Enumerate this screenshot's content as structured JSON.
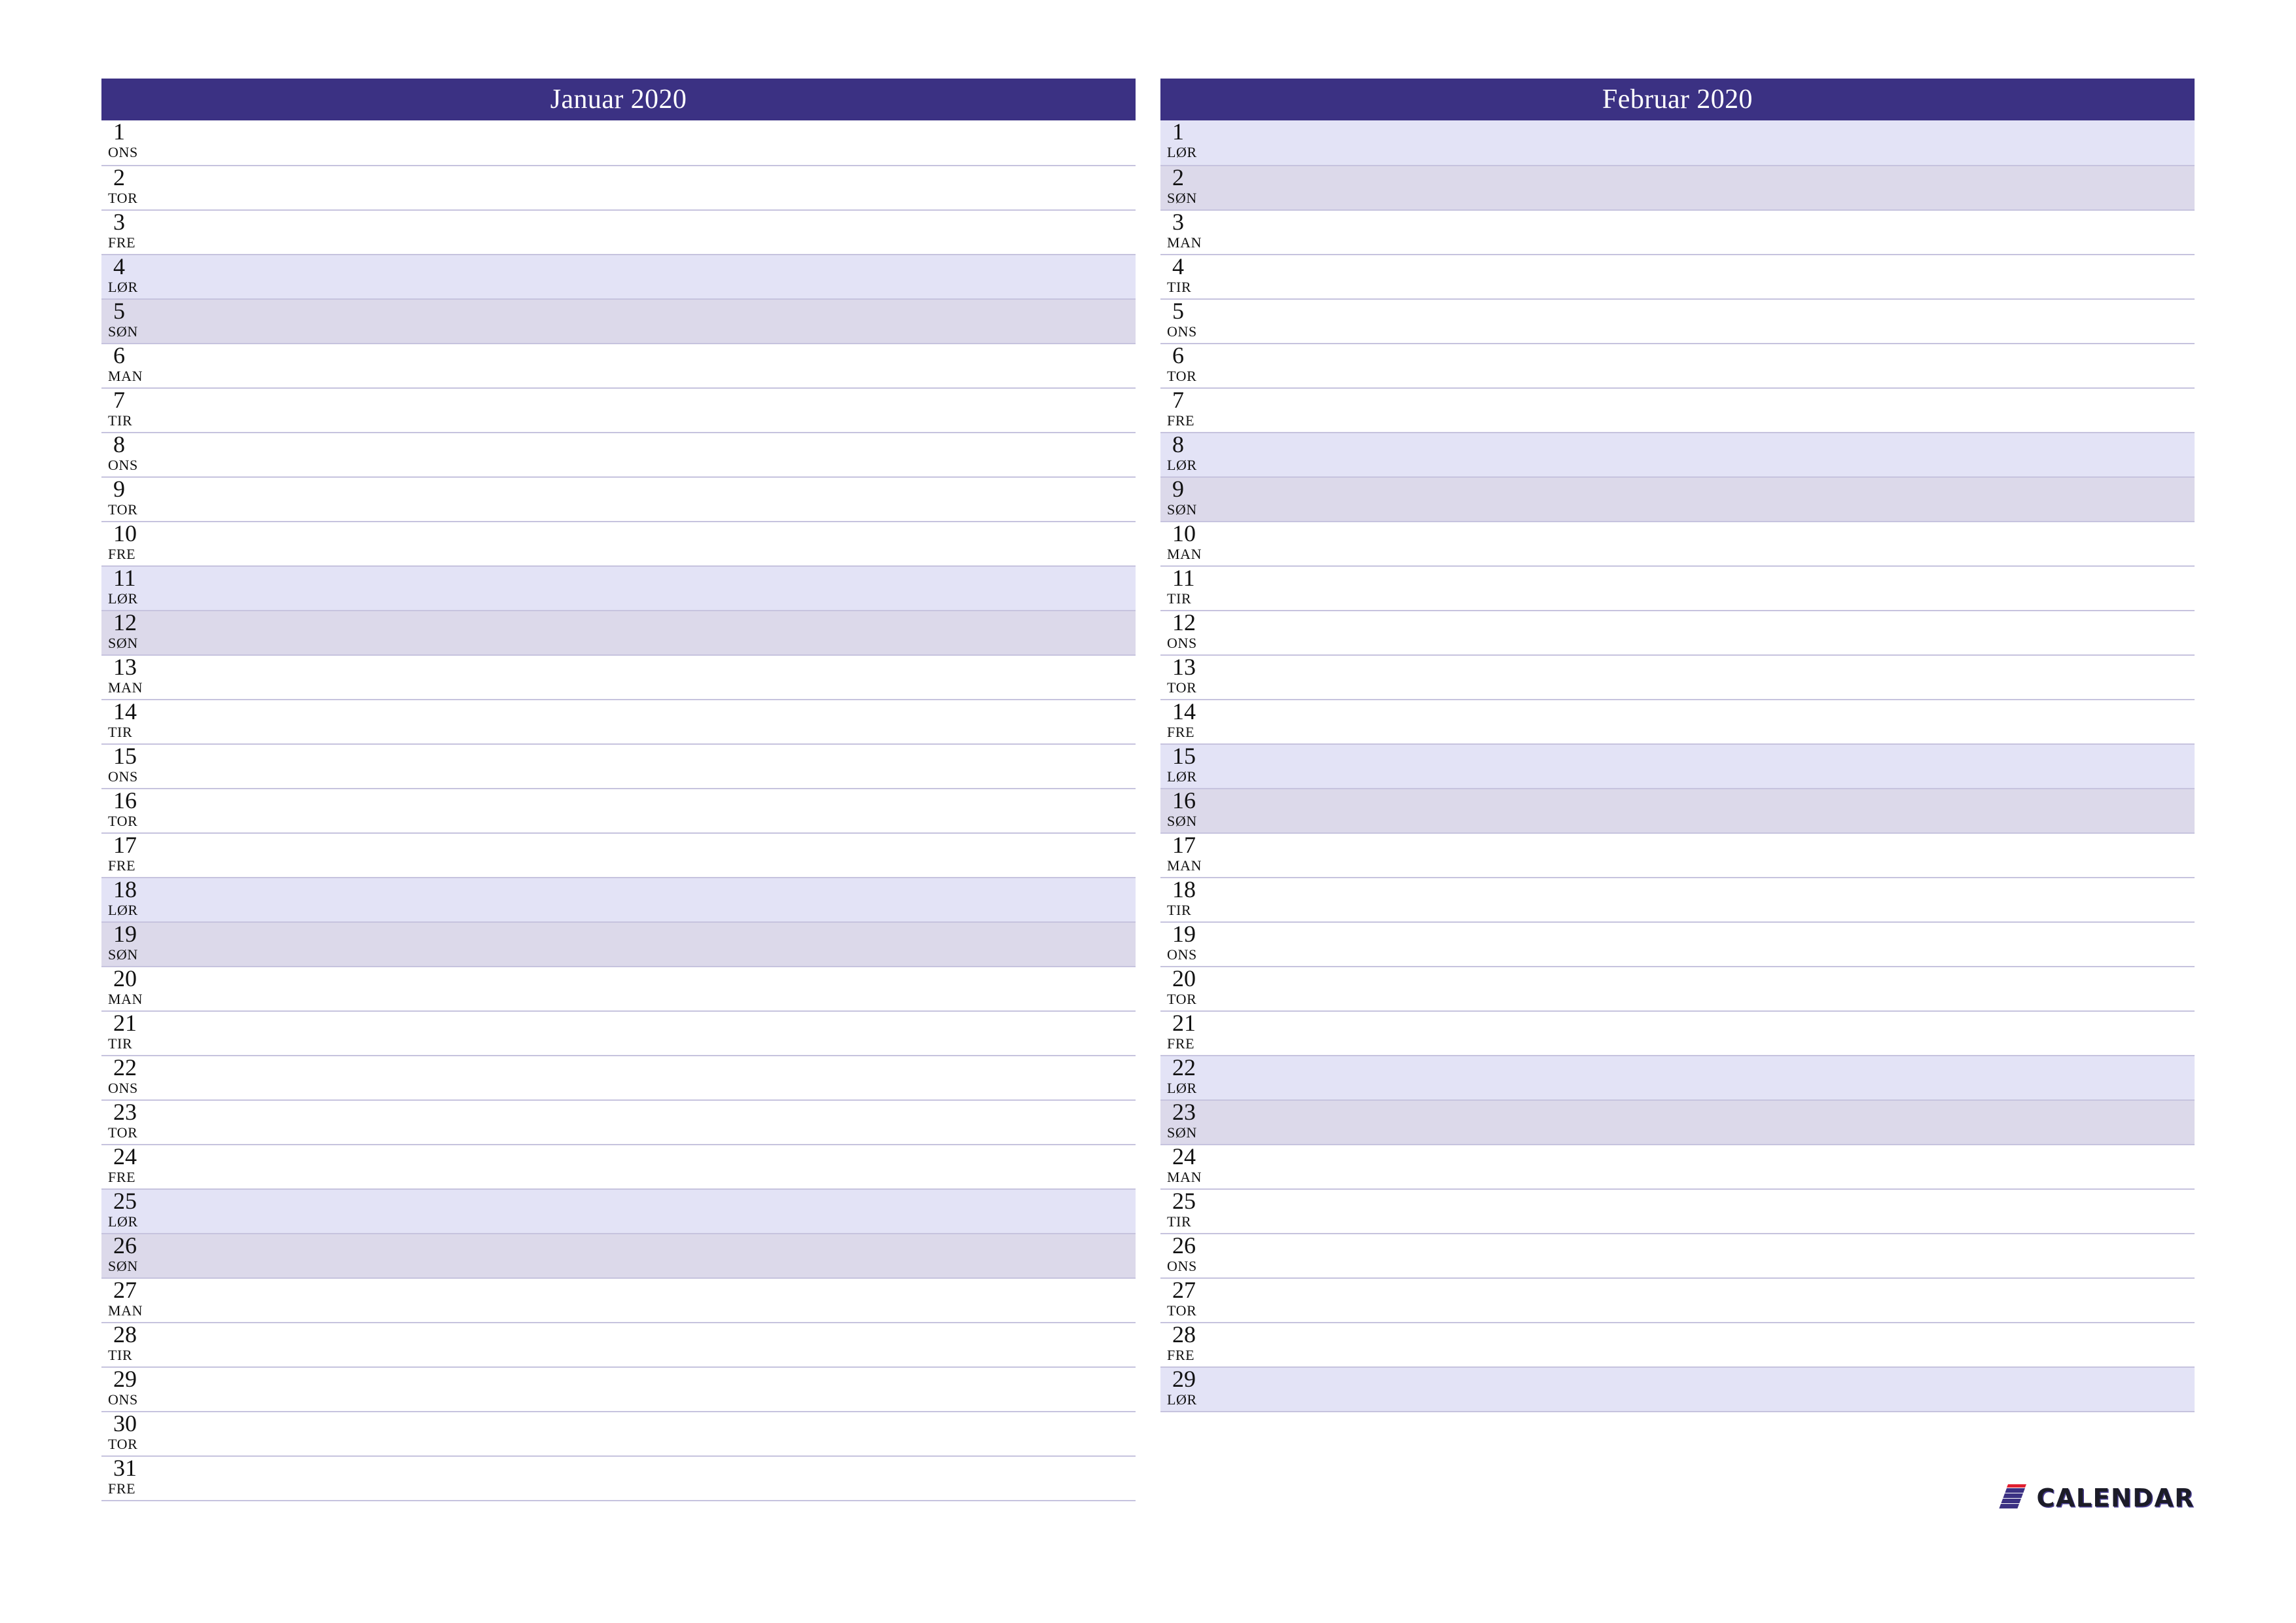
{
  "document": {
    "type": "monthly-planner",
    "year": "2020",
    "locale": "nb-NO"
  },
  "theme": {
    "header_bg": "#3b3183",
    "header_text": "#ffffff",
    "saturday_bg": "#e3e3f6",
    "sunday_bg": "#dcd9ea",
    "weekday_bg": "#ffffff",
    "rule_color": "#c6c3de",
    "text_color": "#111111",
    "brand_mark_color": "#3b3183",
    "brand_mark_accent": "#e02030",
    "brand_text_color": "#1c1c28"
  },
  "months": [
    {
      "title": "Januar 2020",
      "days": [
        {
          "num": "1",
          "name": "ONS",
          "kind": "weekday"
        },
        {
          "num": "2",
          "name": "TOR",
          "kind": "weekday"
        },
        {
          "num": "3",
          "name": "FRE",
          "kind": "weekday"
        },
        {
          "num": "4",
          "name": "LØR",
          "kind": "sat"
        },
        {
          "num": "5",
          "name": "SØN",
          "kind": "sun"
        },
        {
          "num": "6",
          "name": "MAN",
          "kind": "weekday"
        },
        {
          "num": "7",
          "name": "TIR",
          "kind": "weekday"
        },
        {
          "num": "8",
          "name": "ONS",
          "kind": "weekday"
        },
        {
          "num": "9",
          "name": "TOR",
          "kind": "weekday"
        },
        {
          "num": "10",
          "name": "FRE",
          "kind": "weekday"
        },
        {
          "num": "11",
          "name": "LØR",
          "kind": "sat"
        },
        {
          "num": "12",
          "name": "SØN",
          "kind": "sun"
        },
        {
          "num": "13",
          "name": "MAN",
          "kind": "weekday"
        },
        {
          "num": "14",
          "name": "TIR",
          "kind": "weekday"
        },
        {
          "num": "15",
          "name": "ONS",
          "kind": "weekday"
        },
        {
          "num": "16",
          "name": "TOR",
          "kind": "weekday"
        },
        {
          "num": "17",
          "name": "FRE",
          "kind": "weekday"
        },
        {
          "num": "18",
          "name": "LØR",
          "kind": "sat"
        },
        {
          "num": "19",
          "name": "SØN",
          "kind": "sun"
        },
        {
          "num": "20",
          "name": "MAN",
          "kind": "weekday"
        },
        {
          "num": "21",
          "name": "TIR",
          "kind": "weekday"
        },
        {
          "num": "22",
          "name": "ONS",
          "kind": "weekday"
        },
        {
          "num": "23",
          "name": "TOR",
          "kind": "weekday"
        },
        {
          "num": "24",
          "name": "FRE",
          "kind": "weekday"
        },
        {
          "num": "25",
          "name": "LØR",
          "kind": "sat"
        },
        {
          "num": "26",
          "name": "SØN",
          "kind": "sun"
        },
        {
          "num": "27",
          "name": "MAN",
          "kind": "weekday"
        },
        {
          "num": "28",
          "name": "TIR",
          "kind": "weekday"
        },
        {
          "num": "29",
          "name": "ONS",
          "kind": "weekday"
        },
        {
          "num": "30",
          "name": "TOR",
          "kind": "weekday"
        },
        {
          "num": "31",
          "name": "FRE",
          "kind": "weekday"
        }
      ]
    },
    {
      "title": "Februar 2020",
      "days": [
        {
          "num": "1",
          "name": "LØR",
          "kind": "sat"
        },
        {
          "num": "2",
          "name": "SØN",
          "kind": "sun"
        },
        {
          "num": "3",
          "name": "MAN",
          "kind": "weekday"
        },
        {
          "num": "4",
          "name": "TIR",
          "kind": "weekday"
        },
        {
          "num": "5",
          "name": "ONS",
          "kind": "weekday"
        },
        {
          "num": "6",
          "name": "TOR",
          "kind": "weekday"
        },
        {
          "num": "7",
          "name": "FRE",
          "kind": "weekday"
        },
        {
          "num": "8",
          "name": "LØR",
          "kind": "sat"
        },
        {
          "num": "9",
          "name": "SØN",
          "kind": "sun"
        },
        {
          "num": "10",
          "name": "MAN",
          "kind": "weekday"
        },
        {
          "num": "11",
          "name": "TIR",
          "kind": "weekday"
        },
        {
          "num": "12",
          "name": "ONS",
          "kind": "weekday"
        },
        {
          "num": "13",
          "name": "TOR",
          "kind": "weekday"
        },
        {
          "num": "14",
          "name": "FRE",
          "kind": "weekday"
        },
        {
          "num": "15",
          "name": "LØR",
          "kind": "sat"
        },
        {
          "num": "16",
          "name": "SØN",
          "kind": "sun"
        },
        {
          "num": "17",
          "name": "MAN",
          "kind": "weekday"
        },
        {
          "num": "18",
          "name": "TIR",
          "kind": "weekday"
        },
        {
          "num": "19",
          "name": "ONS",
          "kind": "weekday"
        },
        {
          "num": "20",
          "name": "TOR",
          "kind": "weekday"
        },
        {
          "num": "21",
          "name": "FRE",
          "kind": "weekday"
        },
        {
          "num": "22",
          "name": "LØR",
          "kind": "sat"
        },
        {
          "num": "23",
          "name": "SØN",
          "kind": "sun"
        },
        {
          "num": "24",
          "name": "MAN",
          "kind": "weekday"
        },
        {
          "num": "25",
          "name": "TIR",
          "kind": "weekday"
        },
        {
          "num": "26",
          "name": "ONS",
          "kind": "weekday"
        },
        {
          "num": "27",
          "name": "TOR",
          "kind": "weekday"
        },
        {
          "num": "28",
          "name": "FRE",
          "kind": "weekday"
        },
        {
          "num": "29",
          "name": "LØR",
          "kind": "sat"
        }
      ]
    }
  ],
  "brand": {
    "mark_icon": "seven-stripes-logo-icon",
    "text": "CALENDAR"
  }
}
